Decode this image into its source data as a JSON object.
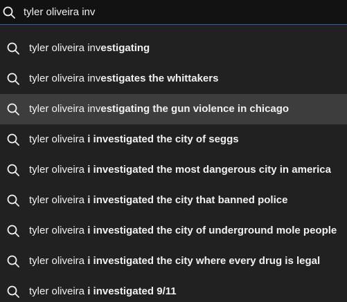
{
  "search": {
    "query": "tyler oliveira inv",
    "icon": "search-icon"
  },
  "suggestions": [
    {
      "typed": "tyler oliveira inv",
      "completion": "estigating",
      "icon": "search-icon",
      "highlighted": false
    },
    {
      "typed": "tyler oliveira inv",
      "completion": "estigates the whittakers",
      "icon": "search-icon",
      "highlighted": false
    },
    {
      "typed": "tyler oliveira inv",
      "completion": "estigating the gun violence in chicago",
      "icon": "search-icon",
      "highlighted": true
    },
    {
      "typed": "tyler oliveira ",
      "completion": "i investigated the city of seggs",
      "icon": "search-icon",
      "highlighted": false
    },
    {
      "typed": "tyler oliveira ",
      "completion": "i investigated the most dangerous city in america",
      "icon": "search-icon",
      "highlighted": false
    },
    {
      "typed": "tyler oliveira ",
      "completion": "i investigated the city that banned police",
      "icon": "search-icon",
      "highlighted": false
    },
    {
      "typed": "tyler oliveira ",
      "completion": "i investigated the city of underground mole people",
      "icon": "search-icon",
      "highlighted": false
    },
    {
      "typed": "tyler oliveira ",
      "completion": "i investigated the city where every drug is legal",
      "icon": "search-icon",
      "highlighted": false
    },
    {
      "typed": "tyler oliveira ",
      "completion": "i investigated 9/11",
      "icon": "search-icon",
      "highlighted": false
    }
  ],
  "colors": {
    "background": "#0f0f0f",
    "dropdown": "#212121",
    "highlight": "#3d3d3d",
    "focus_border": "#1c62b9",
    "text": "#f1f1f1"
  }
}
